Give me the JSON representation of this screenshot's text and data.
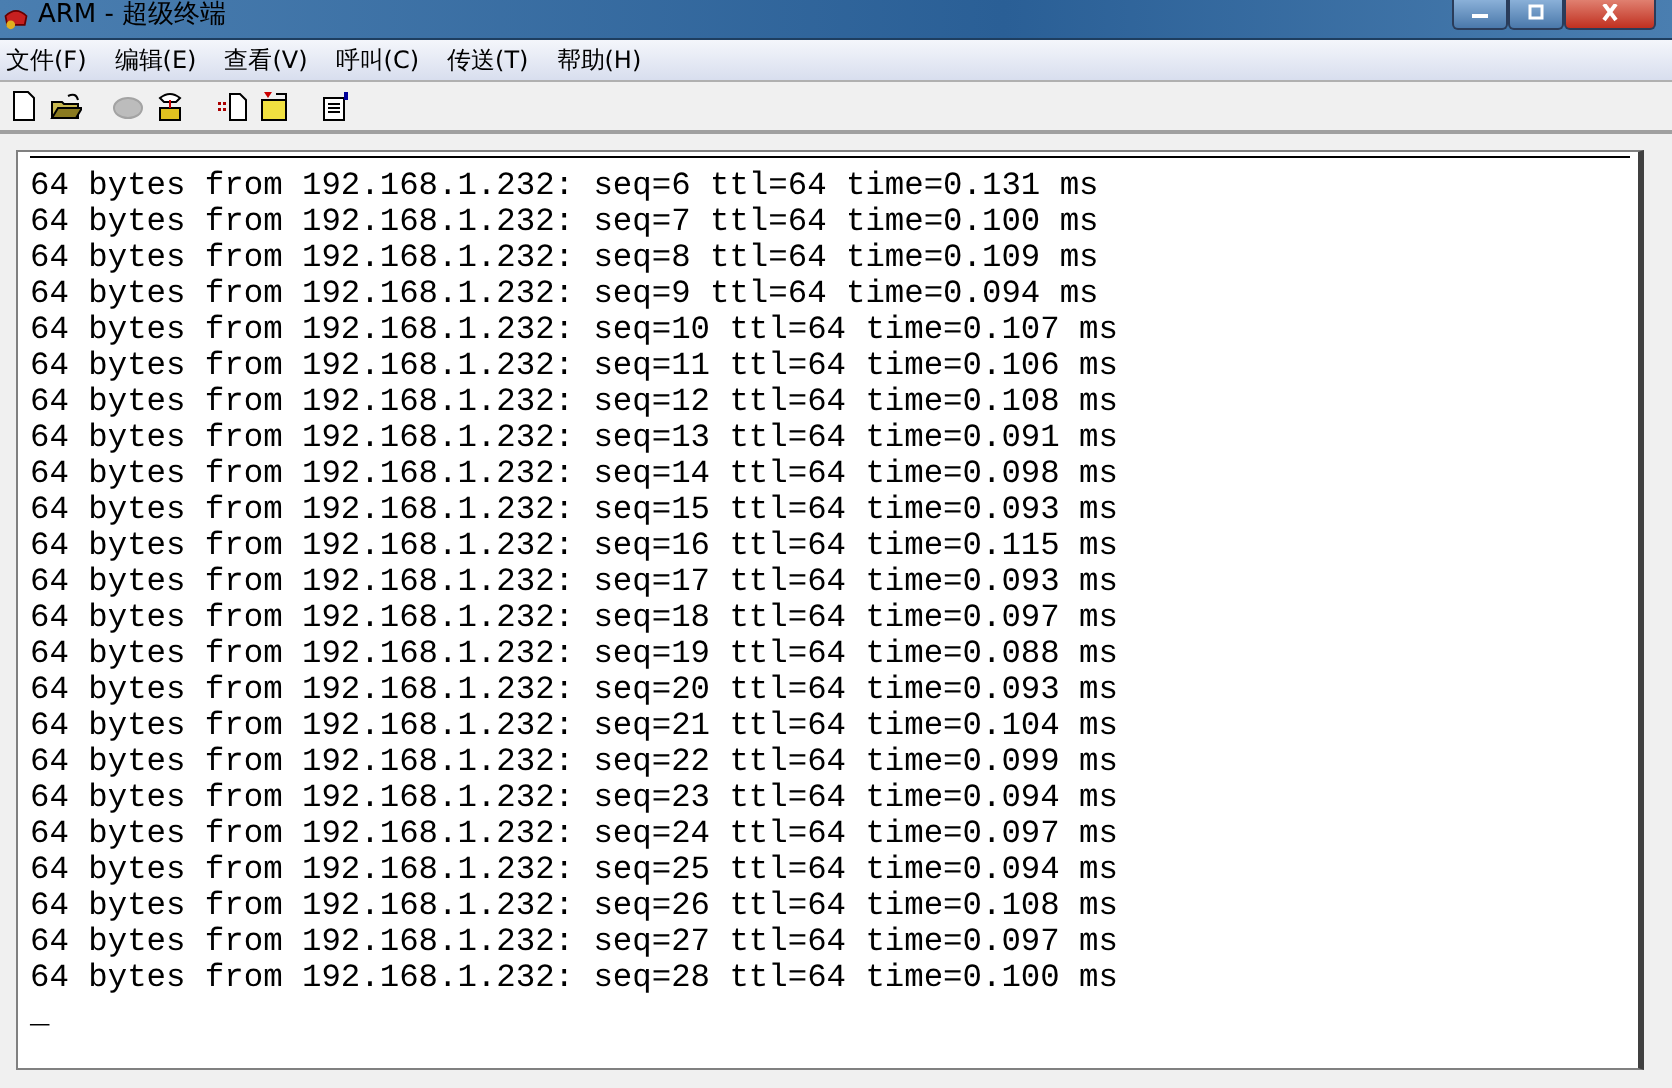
{
  "window": {
    "title": "ARM - 超级终端"
  },
  "menu": [
    "文件(F)",
    "编辑(E)",
    "查看(V)",
    "呼叫(C)",
    "传送(T)",
    "帮助(H)"
  ],
  "toolbar": [
    {
      "kind": "new",
      "disabled": false
    },
    {
      "kind": "open",
      "disabled": false
    },
    {
      "kind": "phone",
      "disabled": true
    },
    {
      "kind": "dial",
      "disabled": false
    },
    {
      "kind": "send",
      "disabled": false
    },
    {
      "kind": "receive",
      "disabled": false
    },
    {
      "kind": "properties",
      "disabled": false
    }
  ],
  "terminal": {
    "lines": [
      "64 bytes from 192.168.1.232: seq=6 ttl=64 time=0.131 ms",
      "64 bytes from 192.168.1.232: seq=7 ttl=64 time=0.100 ms",
      "64 bytes from 192.168.1.232: seq=8 ttl=64 time=0.109 ms",
      "64 bytes from 192.168.1.232: seq=9 ttl=64 time=0.094 ms",
      "64 bytes from 192.168.1.232: seq=10 ttl=64 time=0.107 ms",
      "64 bytes from 192.168.1.232: seq=11 ttl=64 time=0.106 ms",
      "64 bytes from 192.168.1.232: seq=12 ttl=64 time=0.108 ms",
      "64 bytes from 192.168.1.232: seq=13 ttl=64 time=0.091 ms",
      "64 bytes from 192.168.1.232: seq=14 ttl=64 time=0.098 ms",
      "64 bytes from 192.168.1.232: seq=15 ttl=64 time=0.093 ms",
      "64 bytes from 192.168.1.232: seq=16 ttl=64 time=0.115 ms",
      "64 bytes from 192.168.1.232: seq=17 ttl=64 time=0.093 ms",
      "64 bytes from 192.168.1.232: seq=18 ttl=64 time=0.097 ms",
      "64 bytes from 192.168.1.232: seq=19 ttl=64 time=0.088 ms",
      "64 bytes from 192.168.1.232: seq=20 ttl=64 time=0.093 ms",
      "64 bytes from 192.168.1.232: seq=21 ttl=64 time=0.104 ms",
      "64 bytes from 192.168.1.232: seq=22 ttl=64 time=0.099 ms",
      "64 bytes from 192.168.1.232: seq=23 ttl=64 time=0.094 ms",
      "64 bytes from 192.168.1.232: seq=24 ttl=64 time=0.097 ms",
      "64 bytes from 192.168.1.232: seq=25 ttl=64 time=0.094 ms",
      "64 bytes from 192.168.1.232: seq=26 ttl=64 time=0.108 ms",
      "64 bytes from 192.168.1.232: seq=27 ttl=64 time=0.097 ms",
      "64 bytes from 192.168.1.232: seq=28 ttl=64 time=0.100 ms"
    ],
    "cursor": "_"
  }
}
